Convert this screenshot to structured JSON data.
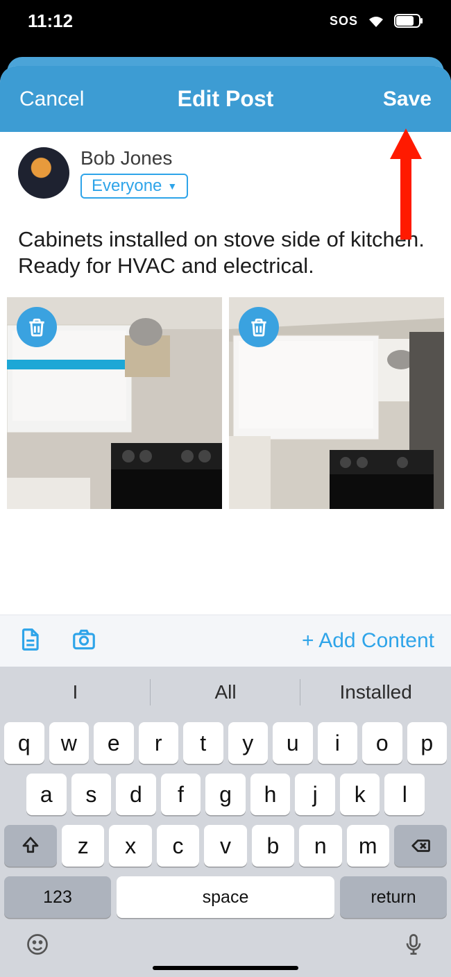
{
  "status": {
    "time": "11:12",
    "sos": "SOS"
  },
  "header": {
    "cancel": "Cancel",
    "title": "Edit Post",
    "save": "Save"
  },
  "author": {
    "name": "Bob Jones",
    "privacy": "Everyone"
  },
  "post": {
    "text": "Cabinets installed on stove side of kitchen. Ready for HVAC and electrical."
  },
  "attach": {
    "add": "+ Add Content"
  },
  "suggestions": [
    "I",
    "All",
    "Installed"
  ],
  "keyboard": {
    "row1": [
      "q",
      "w",
      "e",
      "r",
      "t",
      "y",
      "u",
      "i",
      "o",
      "p"
    ],
    "row2": [
      "a",
      "s",
      "d",
      "f",
      "g",
      "h",
      "j",
      "k",
      "l"
    ],
    "row3": [
      "z",
      "x",
      "c",
      "v",
      "b",
      "n",
      "m"
    ],
    "num": "123",
    "space": "space",
    "return": "return"
  }
}
